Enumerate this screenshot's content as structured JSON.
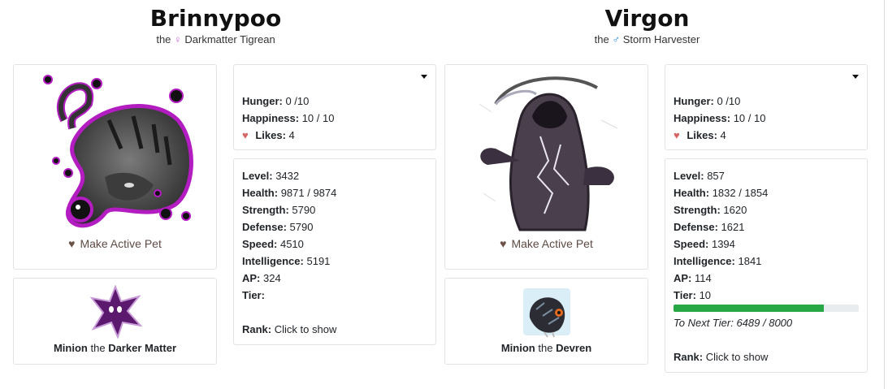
{
  "pets": [
    {
      "name": "Brinnypoo",
      "the": "the",
      "sex_symbol": "♀",
      "species": "Darkmatter Tigrean",
      "active_label": "Make Active Pet",
      "hunger_label": "Hunger:",
      "hunger_value": "0 /10",
      "happiness_label": "Happiness:",
      "happiness_value": "10 / 10",
      "likes_label": "Likes:",
      "likes_value": "4",
      "level_label": "Level:",
      "level": "3432",
      "health_label": "Health:",
      "health": "9871 / 9874",
      "strength_label": "Strength:",
      "strength": "5790",
      "defense_label": "Defense:",
      "defense": "5790",
      "speed_label": "Speed:",
      "speed": "4510",
      "intelligence_label": "Intelligence:",
      "intelligence": "5191",
      "ap_label": "AP:",
      "ap": "324",
      "tier_label": "Tier:",
      "tier": "",
      "rank_label": "Rank:",
      "rank_value": "Click to show",
      "minion_word": "Minion",
      "minion_the": "the",
      "minion_name": "Darker Matter"
    },
    {
      "name": "Virgon",
      "the": "the",
      "sex_symbol": "♂",
      "species": "Storm Harvester",
      "active_label": "Make Active Pet",
      "hunger_label": "Hunger:",
      "hunger_value": "0 /10",
      "happiness_label": "Happiness:",
      "happiness_value": "10 / 10",
      "likes_label": "Likes:",
      "likes_value": "4",
      "level_label": "Level:",
      "level": "857",
      "health_label": "Health:",
      "health": "1832 / 1854",
      "strength_label": "Strength:",
      "strength": "1620",
      "defense_label": "Defense:",
      "defense": "1621",
      "speed_label": "Speed:",
      "speed": "1394",
      "intelligence_label": "Intelligence:",
      "intelligence": "1841",
      "ap_label": "AP:",
      "ap": "114",
      "tier_label": "Tier:",
      "tier": "10",
      "next_tier_label": "To Next Tier:",
      "next_tier_value": "6489 / 8000",
      "next_tier_progress": 0.811,
      "rank_label": "Rank:",
      "rank_value": "Click to show",
      "minion_word": "Minion",
      "minion_the": "the",
      "minion_name": "Devren"
    }
  ],
  "colors": {
    "progress_fill": "#28a745",
    "likes_heart": "#d76565",
    "female": "#c86dd7",
    "male": "#2b8ad8"
  },
  "icons": {
    "active": "heart-icon",
    "likes": "heart-icon",
    "menu": "caret-down-icon",
    "female": "female-symbol-icon",
    "male": "male-symbol-icon"
  }
}
